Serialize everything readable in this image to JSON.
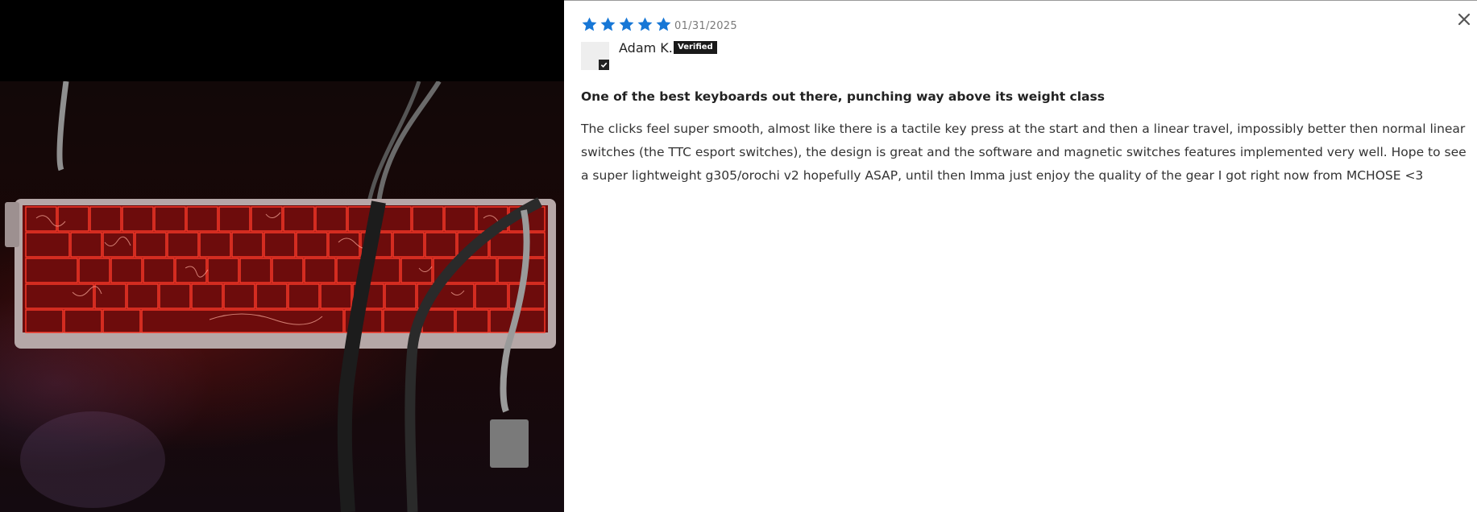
{
  "media": {
    "alt_subject": "keyboard-photo"
  },
  "review": {
    "rating": 5,
    "max_rating": 5,
    "star_color": "#1777d6",
    "date": "01/31/2025",
    "author": "Adam K.",
    "verified_label": "Verified",
    "title": "One of the best keyboards out there, punching way above its weight class",
    "body": "The clicks feel super smooth, almost like there is a tactile key press at the start and then a linear travel, impossibly better then normal linear switches (the TTC esport switches), the design is great and the software and magnetic switches features implemented very well. Hope to see a super lightweight g305/orochi v2 hopefully ASAP, until then Imma just enjoy the quality of the gear I got right now from MCHOSE <3"
  },
  "controls": {
    "close_icon": "close-icon"
  }
}
